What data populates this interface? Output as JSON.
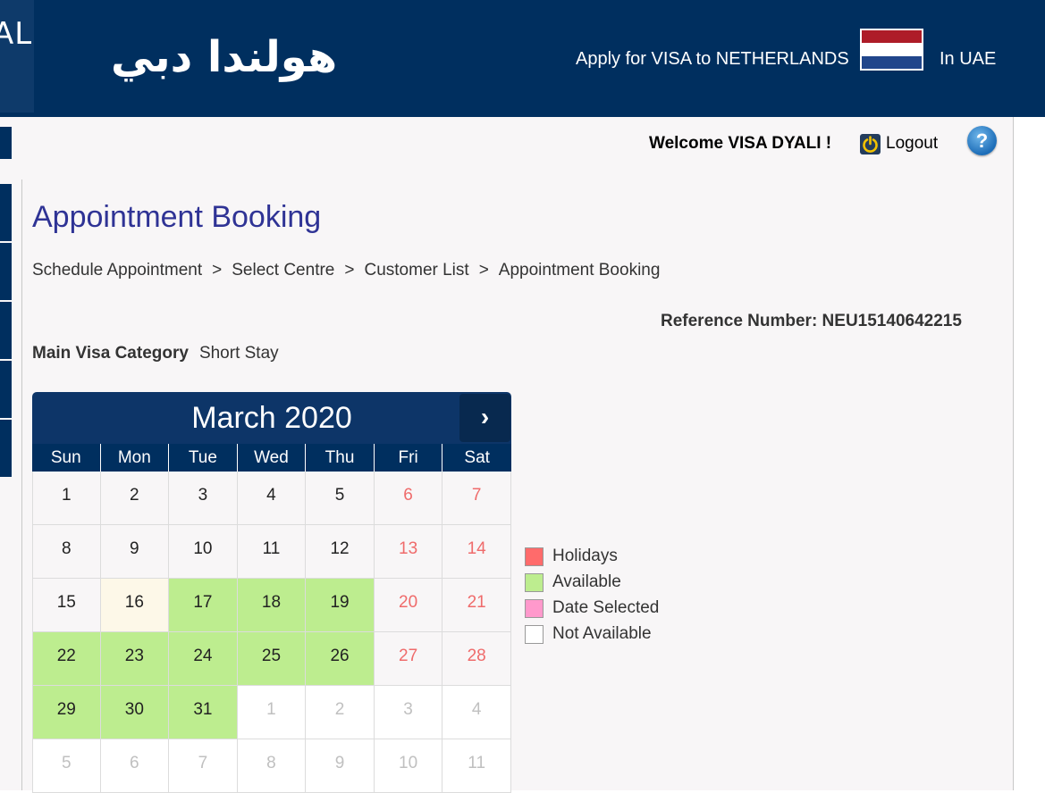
{
  "header": {
    "logo_text": "AL",
    "arabic_title": "هولندا دبي",
    "apply_text": "Apply for VISA to NETHERLANDS",
    "location_text": "In UAE",
    "flag_colors": [
      "#ae1c28",
      "#ffffff",
      "#21468b"
    ]
  },
  "topbar": {
    "welcome": "Welcome VISA DYALI !",
    "logout_label": "Logout",
    "power_icon": "power-icon",
    "help_icon": "help-icon",
    "help_glyph": "?"
  },
  "page": {
    "title": "Appointment Booking",
    "breadcrumb": [
      "Schedule Appointment",
      "Select Centre",
      "Customer List",
      "Appointment Booking"
    ],
    "breadcrumb_separator": ">",
    "reference": "Reference Number: NEU15140642215",
    "visa_category_label": "Main Visa Category",
    "visa_category_value": "Short Stay"
  },
  "calendar": {
    "month_title": "March 2020",
    "next_glyph": "›",
    "weekdays": [
      "Sun",
      "Mon",
      "Tue",
      "Wed",
      "Thu",
      "Fri",
      "Sat"
    ],
    "weeks": [
      [
        {
          "d": "1",
          "s": ""
        },
        {
          "d": "2",
          "s": ""
        },
        {
          "d": "3",
          "s": ""
        },
        {
          "d": "4",
          "s": ""
        },
        {
          "d": "5",
          "s": ""
        },
        {
          "d": "6",
          "s": "holiday"
        },
        {
          "d": "7",
          "s": "holiday"
        }
      ],
      [
        {
          "d": "8",
          "s": ""
        },
        {
          "d": "9",
          "s": ""
        },
        {
          "d": "10",
          "s": ""
        },
        {
          "d": "11",
          "s": ""
        },
        {
          "d": "12",
          "s": ""
        },
        {
          "d": "13",
          "s": "holiday"
        },
        {
          "d": "14",
          "s": "holiday"
        }
      ],
      [
        {
          "d": "15",
          "s": ""
        },
        {
          "d": "16",
          "s": "today"
        },
        {
          "d": "17",
          "s": "avail"
        },
        {
          "d": "18",
          "s": "avail"
        },
        {
          "d": "19",
          "s": "avail"
        },
        {
          "d": "20",
          "s": "holiday"
        },
        {
          "d": "21",
          "s": "holiday"
        }
      ],
      [
        {
          "d": "22",
          "s": "avail"
        },
        {
          "d": "23",
          "s": "avail"
        },
        {
          "d": "24",
          "s": "avail"
        },
        {
          "d": "25",
          "s": "avail"
        },
        {
          "d": "26",
          "s": "avail"
        },
        {
          "d": "27",
          "s": "holiday"
        },
        {
          "d": "28",
          "s": "holiday"
        }
      ],
      [
        {
          "d": "29",
          "s": "avail"
        },
        {
          "d": "30",
          "s": "avail"
        },
        {
          "d": "31",
          "s": "avail"
        },
        {
          "d": "1",
          "s": "other"
        },
        {
          "d": "2",
          "s": "other"
        },
        {
          "d": "3",
          "s": "other"
        },
        {
          "d": "4",
          "s": "other"
        }
      ],
      [
        {
          "d": "5",
          "s": "other"
        },
        {
          "d": "6",
          "s": "other"
        },
        {
          "d": "7",
          "s": "other"
        },
        {
          "d": "8",
          "s": "other"
        },
        {
          "d": "9",
          "s": "other"
        },
        {
          "d": "10",
          "s": "other"
        },
        {
          "d": "11",
          "s": "other"
        }
      ]
    ]
  },
  "legend": [
    {
      "label": "Holidays",
      "color": "#ff6b6b"
    },
    {
      "label": "Available",
      "color": "#bded8f"
    },
    {
      "label": "Date Selected",
      "color": "#ff99cc"
    },
    {
      "label": "Not Available",
      "color": "#ffffff"
    }
  ]
}
